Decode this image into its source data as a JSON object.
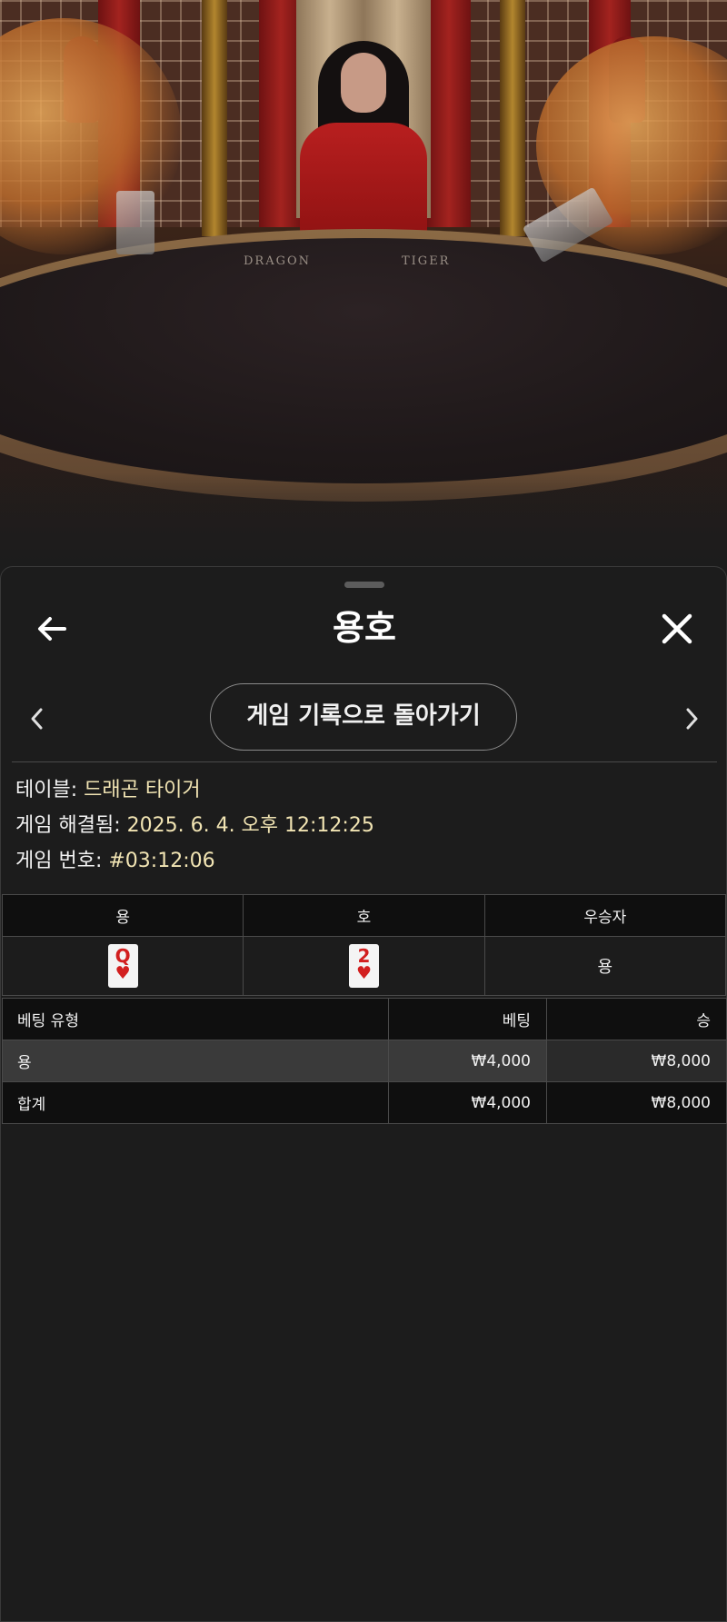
{
  "video": {
    "table_labels": {
      "dragon": "DRAGON",
      "tiger": "TIGER"
    }
  },
  "header": {
    "title": "용호",
    "back_icon": "arrow-left-icon",
    "close_icon": "close-icon"
  },
  "navigation": {
    "prev_icon": "chevron-left-icon",
    "next_icon": "chevron-right-icon",
    "history_button": "게임 기록으로 돌아가기"
  },
  "game_info": {
    "table_label": "테이블:",
    "table_value": "드래곤 타이거",
    "resolved_label": "게임 해결됨:",
    "resolved_value": "2025. 6. 4. 오후 12:12:25",
    "number_label": "게임 번호:",
    "number_value": "#03:12:06"
  },
  "cards_table": {
    "headers": [
      "용",
      "호",
      "우승자"
    ],
    "dragon_card": {
      "rank": "Q",
      "suit": "♥",
      "suit_color": "#d21f1f"
    },
    "tiger_card": {
      "rank": "2",
      "suit": "♥",
      "suit_color": "#d21f1f"
    },
    "winner": "용"
  },
  "bets_table": {
    "headers": [
      "베팅 유형",
      "베팅",
      "승"
    ],
    "rows": [
      {
        "type": "용",
        "bet": "₩4,000",
        "win": "₩8,000"
      }
    ],
    "total": {
      "type": "합계",
      "bet": "₩4,000",
      "win": "₩8,000"
    }
  },
  "colors": {
    "background": "#1c1c1c",
    "value_text": "#f1e4b3",
    "header_row": "#0f0f0f",
    "highlight_row": "#3a3a3a",
    "border": "#4a4a4a"
  }
}
